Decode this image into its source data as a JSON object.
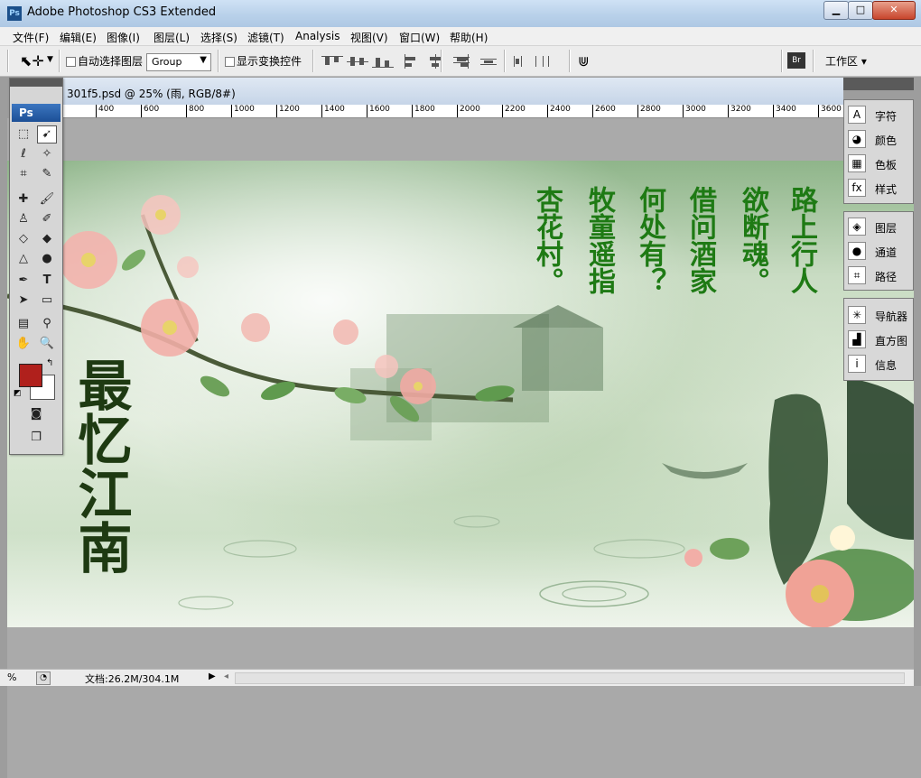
{
  "window": {
    "title": "Adobe Photoshop CS3 Extended",
    "icon_text": "Ps"
  },
  "window_controls": {
    "minimize": "▁",
    "maximize": "□",
    "close": "✕"
  },
  "menu": [
    "文件(F)",
    "编辑(E)",
    "图像(I)",
    "图层(L)",
    "选择(S)",
    "滤镜(T)",
    "Analysis",
    "视图(V)",
    "窗口(W)",
    "帮助(H)"
  ],
  "options": {
    "auto_select_label": "自动选择图层",
    "auto_select_value": "Group",
    "transform_label": "显示变换控件",
    "workspace_label": "工作区 ▾"
  },
  "document": {
    "title": "301f5.psd @ 25% (雨, RGB/8#)",
    "ruler_labels": [
      "400",
      "600",
      "800",
      "1000",
      "1200",
      "1400",
      "1600",
      "1800",
      "2000",
      "2200",
      "2400",
      "2600",
      "2800",
      "3000",
      "3200",
      "3400",
      "3600"
    ]
  },
  "status": {
    "zoom": "%",
    "doc_size": "文档:26.2M/304.1M"
  },
  "tools": {
    "logo": "Ps"
  },
  "right_panels": [
    [
      {
        "icon": "A",
        "label": "字符"
      },
      {
        "icon": "◕",
        "label": "颜色"
      },
      {
        "icon": "▦",
        "label": "色板"
      },
      {
        "icon": "fx",
        "label": "样式"
      }
    ],
    [
      {
        "icon": "◈",
        "label": "图层"
      },
      {
        "icon": "●",
        "label": "通道"
      },
      {
        "icon": "⌗",
        "label": "路径"
      }
    ],
    [
      {
        "icon": "✳",
        "label": "导航器"
      },
      {
        "icon": "▟",
        "label": "直方图"
      },
      {
        "icon": "i",
        "label": "信息"
      }
    ]
  ],
  "artwork": {
    "poem": [
      "路上行人",
      "欲断魂。",
      "借问酒家",
      "何处有？",
      "牧童遥指",
      "杏花村。"
    ],
    "calligraphy": "最忆江南"
  }
}
